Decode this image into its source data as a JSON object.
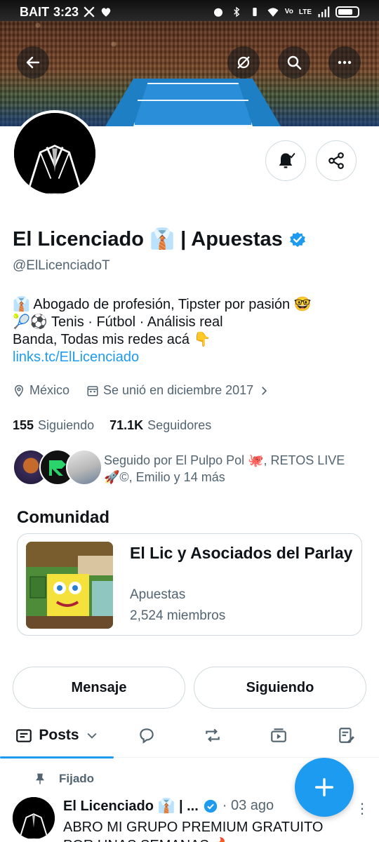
{
  "status_bar": {
    "carrier": "BAIT",
    "time": "3:23",
    "network": "LTE",
    "volte": "Vo"
  },
  "profile": {
    "name": "El Licenciado 👔 | Apuestas",
    "handle": "@ElLicenciadoT",
    "bio_line1": "👔 Abogado de profesión, Tipster por pasión 🤓",
    "bio_line2": "🎾⚽ Tenis · Fútbol · Análisis real",
    "bio_line3": "Banda, Todas mis redes acá 👇",
    "bio_link": "links.tc/ElLicenciado",
    "location": "México",
    "joined": "Se unió en diciembre 2017",
    "following_count": "155",
    "following_label": "Siguiendo",
    "followers_count": "71.1K",
    "followers_label": "Seguidores",
    "followed_by_line1": "Seguido por El Pulpo Pol 🐙, RETOS LIVE",
    "followed_by_line2": "🚀©, Emilio y 14 más"
  },
  "community": {
    "section_title": "Comunidad",
    "name": "El Lic y Asociados del Parlay",
    "category": "Apuestas",
    "members": "2,524 miembros"
  },
  "actions": {
    "message": "Mensaje",
    "following": "Siguiendo"
  },
  "tabs": {
    "posts": "Posts"
  },
  "post": {
    "pinned_label": "Fijado",
    "author": "El Licenciado 👔 | ...",
    "time": "· 03 ago",
    "text": "ABRO MI GRUPO PREMIUM GRATUITO POR UNAS SEMANAS 🔥"
  },
  "colors": {
    "accent": "#1d9bf0",
    "text": "#0f1419",
    "muted": "#536471",
    "border": "#cfd9de"
  }
}
